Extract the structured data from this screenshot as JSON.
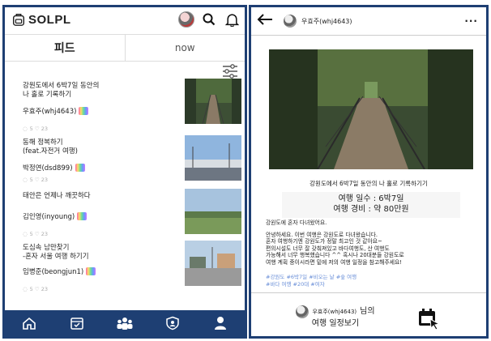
{
  "left": {
    "app_name": "SOLPL",
    "tabs": {
      "feed": "피드",
      "now": "now"
    },
    "feed": [
      {
        "title_line1": "강원도에서 6박7일 동안의",
        "title_line2": "나 홀로 기록하기",
        "user": "우효주(whj4643)",
        "stats": "5 ♡ 23"
      },
      {
        "title_line1": "동해 정복하기",
        "title_line2": "(feat.자전거 여행)",
        "user": "박정연(dsd899)",
        "stats": "5 ♡ 23"
      },
      {
        "title_line1": "태안은 언제나 깨끗하다",
        "title_line2": "",
        "user": "김인영(inyoung)",
        "stats": "5 ♡ 23"
      },
      {
        "title_line1": "도심속 남만찾기",
        "title_line2": "-혼자 서울 여행 하기기",
        "user": "임병준(beongjun1)",
        "stats": "5 ♡ 23"
      }
    ]
  },
  "right": {
    "header_user": "우효주(whj4643)",
    "post_title": "강원도에서 6박7일 동안의 나 홀로 기록하기기",
    "days_line": "여행 일수 : 6박7일",
    "cost_line": "여행 경비 : 약 80만원",
    "body_intro": "강원도에 혼자 다녀왔어요.",
    "body_lines": [
      "안녕하세요. 이번 여행은 강원도로 다녀왔습니다.",
      "혼자 여행하기엔 강원도가 정말 최고인 것 같아요~",
      "편의시설도 너무 잘 갖춰져있고 바다여행도, 산 여행도",
      "가능해서 너무 행복했습니다 ^^ 혹시나 20대분들 강원도로",
      "여행 계획 중이시라면 밑에 저의 여행 일정을 참고해주세요!"
    ],
    "tags_line1": "#강원도 #6박7일 #비오는 날 #숲 여행",
    "tags_line2": "#바다 여행 #20대 #여자",
    "plan_user": "우효주(whj4643)",
    "plan_suffix": "님의",
    "plan_line2": "여행 일정보기"
  }
}
